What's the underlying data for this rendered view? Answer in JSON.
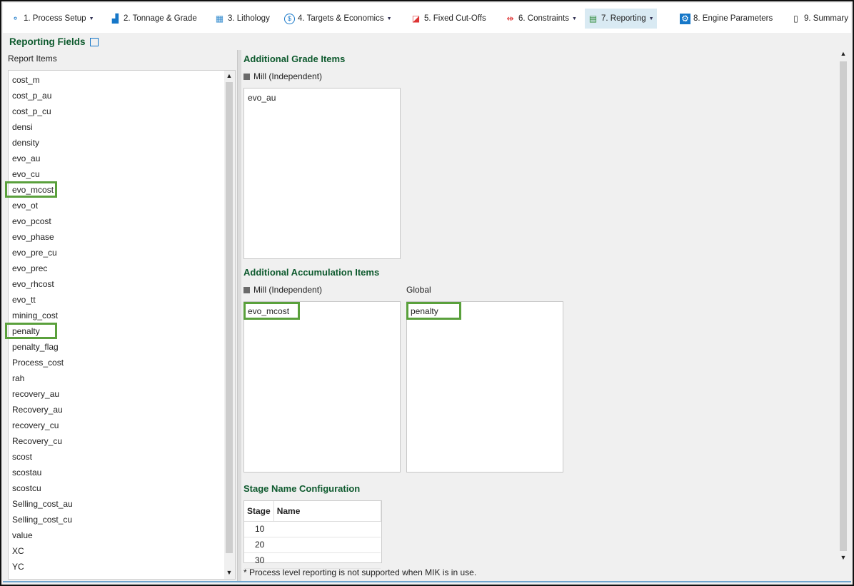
{
  "toolbar": {
    "tabs": [
      {
        "label": "1. Process Setup",
        "icon": "process-setup-icon",
        "dropdown": true
      },
      {
        "label": "2. Tonnage & Grade",
        "icon": "chart-icon",
        "dropdown": false
      },
      {
        "label": "3. Lithology",
        "icon": "lithology-icon",
        "dropdown": false
      },
      {
        "label": "4. Targets & Economics",
        "icon": "dollar-icon",
        "dropdown": true
      },
      {
        "label": "5. Fixed Cut-Offs",
        "icon": "cutoff-icon",
        "dropdown": false
      },
      {
        "label": "6. Constraints",
        "icon": "constraints-icon",
        "dropdown": true
      },
      {
        "label": "7. Reporting",
        "icon": "reporting-icon",
        "dropdown": true,
        "active": true
      },
      {
        "label": "8. Engine Parameters",
        "icon": "gear-icon",
        "dropdown": false
      },
      {
        "label": "9. Summary",
        "icon": "summary-icon",
        "dropdown": false
      }
    ]
  },
  "left": {
    "title": "Reporting Fields",
    "subtitle": "Report Items",
    "items": [
      "cost_m",
      "cost_p_au",
      "cost_p_cu",
      "densi",
      "density",
      "evo_au",
      "evo_cu",
      "evo_mcost",
      "evo_ot",
      "evo_pcost",
      "evo_phase",
      "evo_pre_cu",
      "evo_prec",
      "evo_rhcost",
      "evo_tt",
      "mining_cost",
      "penalty",
      "penalty_flag",
      "Process_cost",
      "rah",
      "recovery_au",
      "Recovery_au",
      "recovery_cu",
      "Recovery_cu",
      "scost",
      "scostau",
      "scostcu",
      "Selling_cost_au",
      "Selling_cost_cu",
      "value",
      "XC",
      "YC"
    ],
    "highlighted": [
      "evo_mcost",
      "penalty"
    ]
  },
  "grade": {
    "title": "Additional Grade Items",
    "mill_label": "Mill (Independent)",
    "mill_items": [
      "evo_au"
    ]
  },
  "accum": {
    "title": "Additional Accumulation Items",
    "mill_label": "Mill (Independent)",
    "mill_items": [
      "evo_mcost"
    ],
    "global_label": "Global",
    "global_items": [
      "penalty"
    ]
  },
  "stage": {
    "title": "Stage Name Configuration",
    "headers": [
      "Stage",
      "Name"
    ],
    "rows": [
      [
        "10",
        ""
      ],
      [
        "20",
        ""
      ],
      [
        "30",
        ""
      ]
    ]
  },
  "note": "* Process level reporting is not supported when MIK is in use.",
  "colors": {
    "heading": "#0e5a2e",
    "highlight": "#5aa03c",
    "active_tab": "#d9eaf3"
  }
}
